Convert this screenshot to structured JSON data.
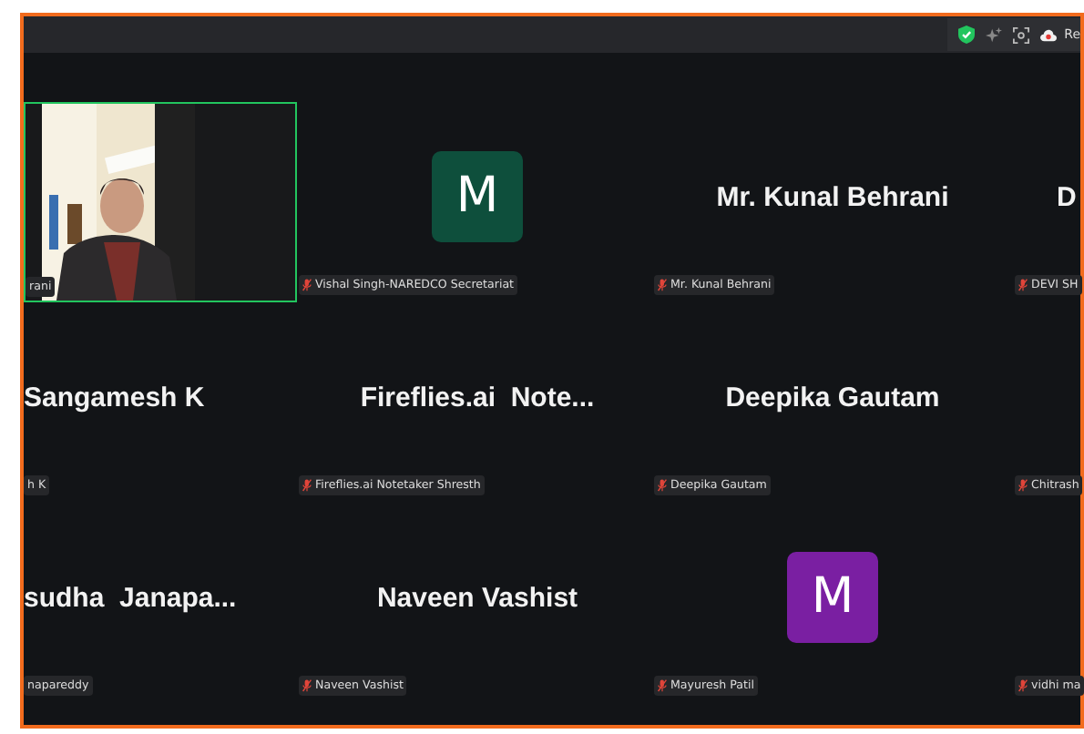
{
  "top_bar": {
    "record_label": "Re"
  },
  "tiles": [
    {
      "kind": "video",
      "muted": false,
      "label": "rani",
      "active_speaker": true
    },
    {
      "kind": "avatar",
      "letter": "M",
      "color": "#0e4f3c",
      "muted": true,
      "label": "Vishal Singh-NAREDCO Secretariat"
    },
    {
      "kind": "name",
      "name": "Mr. Kunal Behrani",
      "muted": true,
      "label": "Mr. Kunal Behrani"
    },
    {
      "kind": "name",
      "name": "D",
      "muted": true,
      "label": "DEVI SH"
    },
    {
      "kind": "name",
      "name": "Sangamesh K",
      "muted": false,
      "label": "h K"
    },
    {
      "kind": "name",
      "name": "Fireflies.ai  Note...",
      "muted": true,
      "label": "Fireflies.ai Notetaker Shresth"
    },
    {
      "kind": "name",
      "name": "Deepika Gautam",
      "muted": true,
      "label": "Deepika Gautam"
    },
    {
      "kind": "blank",
      "muted": true,
      "label": "Chitrash"
    },
    {
      "kind": "name",
      "name": "sudha  Janapa...",
      "muted": false,
      "label": "napareddy"
    },
    {
      "kind": "name",
      "name": "Naveen Vashist",
      "muted": true,
      "label": "Naveen Vashist"
    },
    {
      "kind": "avatar",
      "letter": "M",
      "color": "#7a1fa2",
      "muted": true,
      "label": "Mayuresh Patil"
    },
    {
      "kind": "blank",
      "muted": true,
      "label": "vidhi ma"
    }
  ]
}
